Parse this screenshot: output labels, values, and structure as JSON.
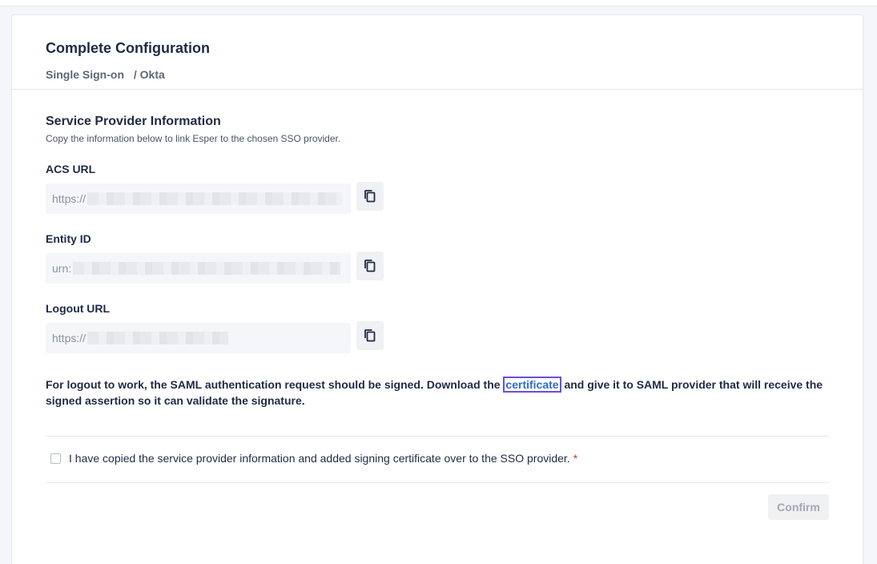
{
  "header": {
    "title": "Complete Configuration",
    "breadcrumb": [
      "Single Sign-on",
      "/ Okta"
    ]
  },
  "section": {
    "title": "Service Provider Information",
    "subtitle": "Copy the information below to link Esper to the chosen SSO provider."
  },
  "fields": {
    "acs": {
      "label": "ACS URL",
      "value_prefix": "https://"
    },
    "entity": {
      "label": "Entity ID",
      "value_prefix": "urn:"
    },
    "logout": {
      "label": "Logout URL",
      "value_prefix": "https://"
    }
  },
  "note": {
    "before": "For logout to work, the SAML authentication request should be signed. Download the ",
    "link": "certificate",
    "after": " and give it to SAML provider that will receive the signed assertion so it can validate the signature."
  },
  "agreement": {
    "label": "I have copied the service provider information and added signing certificate over to the SSO provider.",
    "required_mark": "*"
  },
  "actions": {
    "confirm": "Confirm"
  },
  "icons": {
    "copy": "copy-icon"
  }
}
